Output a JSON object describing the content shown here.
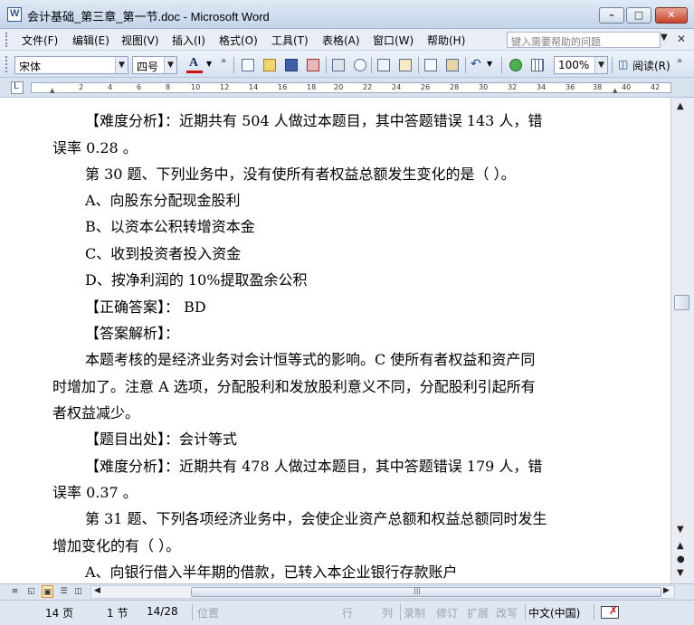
{
  "window": {
    "title": "会计基础_第三章_第一节.doc - Microsoft Word",
    "min_glyph": "–",
    "max_glyph": "□",
    "close_glyph": "✕"
  },
  "menu": {
    "items": [
      "文件(F)",
      "编辑(E)",
      "视图(V)",
      "插入(I)",
      "格式(O)",
      "工具(T)",
      "表格(A)",
      "窗口(W)",
      "帮助(H)"
    ],
    "help_placeholder": "键入需要帮助的问题",
    "close_glyph": "✕"
  },
  "toolbar": {
    "font_name": "宋体",
    "font_size": "四号",
    "font_color_label": "A",
    "zoom": "100%",
    "reading_label": "阅读(R)"
  },
  "ruler": {
    "corner": "L",
    "ticks": [
      "2",
      "4",
      "6",
      "8",
      "10",
      "12",
      "14",
      "16",
      "18",
      "20",
      "22",
      "24",
      "26",
      "28",
      "30",
      "32",
      "34",
      "36",
      "38",
      "40",
      "42"
    ]
  },
  "document": {
    "lines": [
      "【难度分析】：近期共有 504 人做过本题目，其中答题错误 143 人，错",
      "误率 0.28 。",
      "第 30 题、下列业务中，没有使所有者权益总额发生变化的是（ ）。",
      "A、向股东分配现金股利",
      "B、以资本公积转增资本金",
      "C、收到投资者投入资金",
      "D、按净利润的 10%提取盈余公积",
      "【正确答案】： BD",
      "【答案解析】：",
      "本题考核的是经济业务对会计恒等式的影响。C 使所有者权益和资产同",
      "时增加了。注意 A 选项，分配股利和发放股利意义不同，分配股利引起所有",
      "者权益减少。",
      "【题目出处】：会计等式",
      "【难度分析】：近期共有 478 人做过本题目，其中答题错误 179 人，错",
      "误率 0.37 。",
      "第 31 题、下列各项经济业务中，会使企业资产总额和权益总额同时发生",
      "增加变化的有（ ）。",
      "A、向银行借入半年期的借款，已转入本企业银行存款账户"
    ]
  },
  "status": {
    "page": "14 页",
    "section": "1 节",
    "page_of": "14/28",
    "position": "位置",
    "line": "行",
    "column": "列",
    "rec": "录制",
    "trk": "修订",
    "ext": "扩展",
    "ovr": "改写",
    "language": "中文(中国)"
  }
}
